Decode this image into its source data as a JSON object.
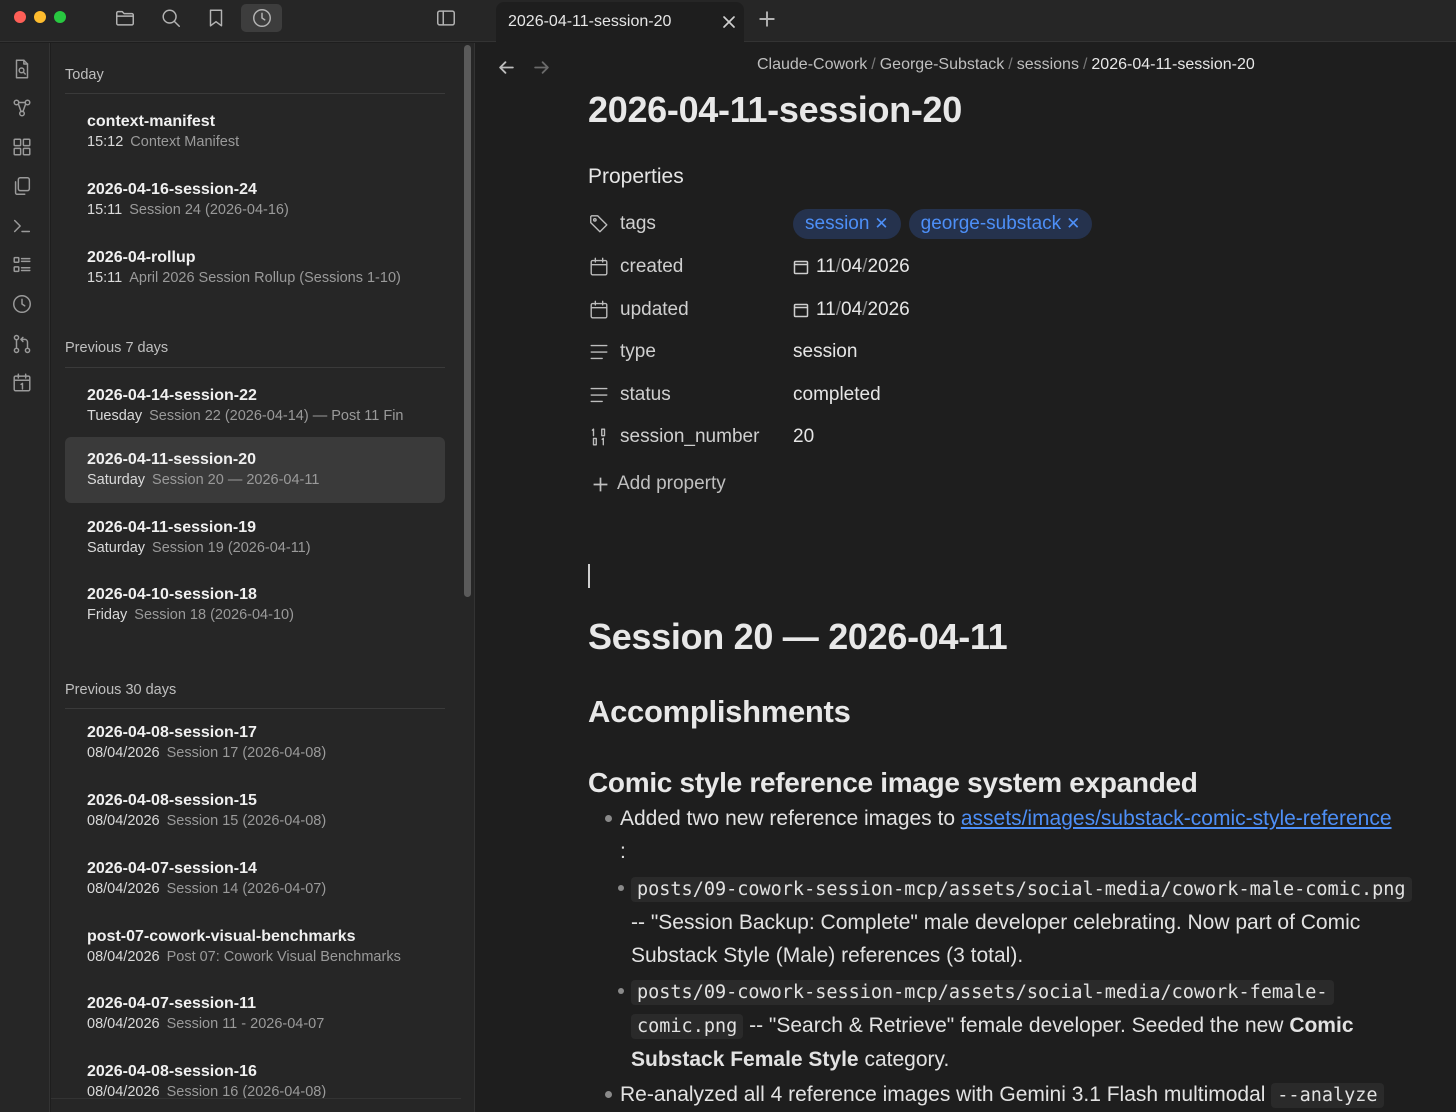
{
  "window": {
    "tab_title": "2026-04-11-session-20"
  },
  "sidebar": {
    "groups": [
      {
        "label": "Today",
        "items": [
          {
            "title": "context-manifest",
            "date": "15:12",
            "desc": "Context Manifest"
          },
          {
            "title": "2026-04-16-session-24",
            "date": "15:11",
            "desc": "Session 24 (2026-04-16)"
          },
          {
            "title": "2026-04-rollup",
            "date": "15:11",
            "desc": "April 2026 Session Rollup (Sessions 1-10)"
          }
        ]
      },
      {
        "label": "Previous 7 days",
        "items": [
          {
            "title": "2026-04-14-session-22",
            "date": "Tuesday",
            "desc": "Session 22 (2026-04-14) — Post 11 Fin"
          },
          {
            "title": "2026-04-11-session-20",
            "date": "Saturday",
            "desc": "Session 20 — 2026-04-11"
          },
          {
            "title": "2026-04-11-session-19",
            "date": "Saturday",
            "desc": "Session 19 (2026-04-11)"
          },
          {
            "title": "2026-04-10-session-18",
            "date": "Friday",
            "desc": "Session 18 (2026-04-10)"
          }
        ]
      },
      {
        "label": "Previous 30 days",
        "items": [
          {
            "title": "2026-04-08-session-17",
            "date": "08/04/2026",
            "desc": "Session 17 (2026-04-08)"
          },
          {
            "title": "2026-04-08-session-15",
            "date": "08/04/2026",
            "desc": "Session 15 (2026-04-08)"
          },
          {
            "title": "2026-04-07-session-14",
            "date": "08/04/2026",
            "desc": "Session 14 (2026-04-07)"
          },
          {
            "title": "post-07-cowork-visual-benchmarks",
            "date": "08/04/2026",
            "desc": "Post 07: Cowork Visual Benchmarks"
          },
          {
            "title": "2026-04-07-session-11",
            "date": "08/04/2026",
            "desc": "Session 11 - 2026-04-07"
          },
          {
            "title": "2026-04-08-session-16",
            "date": "08/04/2026",
            "desc": "Session 16 (2026-04-08)"
          }
        ]
      }
    ]
  },
  "breadcrumb": [
    "Claude-Cowork",
    "George-Substack",
    "sessions",
    "2026-04-11-session-20"
  ],
  "doc": {
    "title": "2026-04-11-session-20",
    "properties_heading": "Properties",
    "properties": {
      "tags": {
        "key": "tags",
        "values": [
          "session",
          "george-substack"
        ]
      },
      "created": {
        "key": "created",
        "day": "11",
        "month": "04",
        "year": "2026"
      },
      "updated": {
        "key": "updated",
        "day": "11",
        "month": "04",
        "year": "2026"
      },
      "type": {
        "key": "type",
        "value": "session"
      },
      "status": {
        "key": "status",
        "value": "completed"
      },
      "session_number": {
        "key": "session_number",
        "value": "20"
      }
    },
    "add_property": "Add property",
    "h1": "Session 20 — 2026-04-11",
    "h2": "Accomplishments",
    "h3": "Comic style reference image system expanded",
    "bullet1_text": "Added two new reference images to",
    "bullet1_link": "assets/images/substack-comic-style-reference",
    "bullet1_colon": ":",
    "sub1_code": "posts/09-cowork-session-mcp/assets/social-media/cowork-male-comic.png",
    "sub1_line1": "-- \"Session Backup: Complete\" male developer celebrating. Now part of Comic",
    "sub1_line2": "Substack Style (Male) references (3 total).",
    "sub2_code1": "posts/09-cowork-session-mcp/assets/social-media/cowork-female-",
    "sub2_code2": "comic.png",
    "sub2_text1": "-- \"Search & Retrieve\" female developer. Seeded the new",
    "sub2_bold1": "Comic",
    "sub2_bold2": "Substack Female Style",
    "sub2_text2": "category.",
    "bullet2_text": "Re-analyzed all 4 reference images with Gemini 3.1 Flash multimodal",
    "bullet2_code": "--analyze"
  }
}
